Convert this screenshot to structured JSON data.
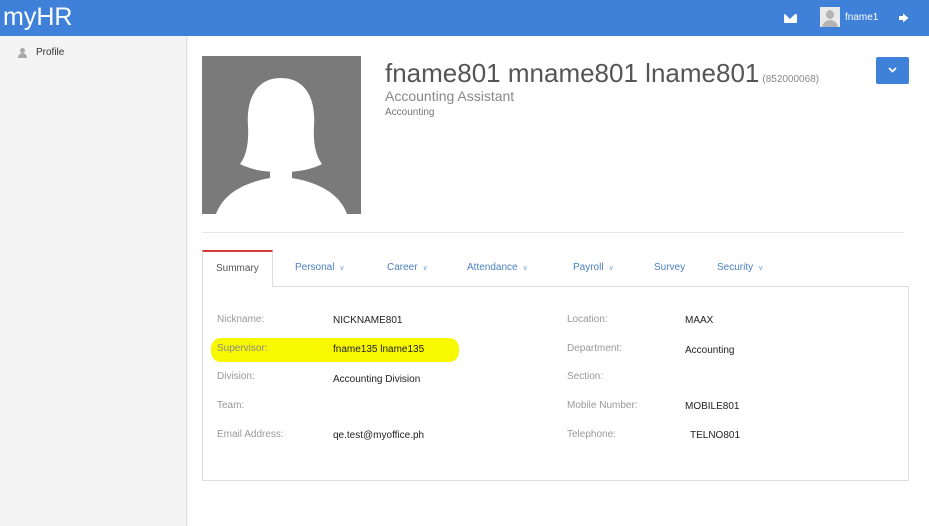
{
  "app": {
    "title": "myHR"
  },
  "user": {
    "name": "fname1"
  },
  "sidebar": {
    "items": [
      {
        "label": "Profile",
        "icon": "user-icon"
      }
    ]
  },
  "profile": {
    "full_name": "fname801 mname801 lname801",
    "employee_no": "(852000068)",
    "job_title": "Accounting Assistant",
    "department": "Accounting"
  },
  "tabs": [
    {
      "label": "Summary",
      "active": true,
      "has_caret": false
    },
    {
      "label": "Personal",
      "active": false,
      "has_caret": true
    },
    {
      "label": "Career",
      "active": false,
      "has_caret": true
    },
    {
      "label": "Attendance",
      "active": false,
      "has_caret": true
    },
    {
      "label": "Payroll",
      "active": false,
      "has_caret": true
    },
    {
      "label": "Survey",
      "active": false,
      "has_caret": false
    },
    {
      "label": "Security",
      "active": false,
      "has_caret": true
    }
  ],
  "summary": {
    "left": [
      {
        "label": "Nickname:",
        "value": "NICKNAME801"
      },
      {
        "label": "Supervisor:",
        "value": "fname135 lname135",
        "highlighted": true
      },
      {
        "label": "Division:",
        "value": "Accounting Division"
      },
      {
        "label": "Team:",
        "value": ""
      },
      {
        "label": "Email Address:",
        "value": "qe.test@myoffice.ph"
      }
    ],
    "right": [
      {
        "label": "Location:",
        "value": "MAAX"
      },
      {
        "label": "Department:",
        "value": "Accounting"
      },
      {
        "label": "Section:",
        "value": ""
      },
      {
        "label": "Mobile Number:",
        "value": "MOBILE801"
      },
      {
        "label": "Telephone:",
        "value": "TELNO801"
      }
    ]
  },
  "colors": {
    "accent": "#3f80d9",
    "active_tab_border": "#d43f3a",
    "highlight": "#f8f800"
  },
  "icons": {
    "mail": "mail-icon",
    "logout": "logout-icon",
    "dropdown": "chevron-down-icon"
  }
}
